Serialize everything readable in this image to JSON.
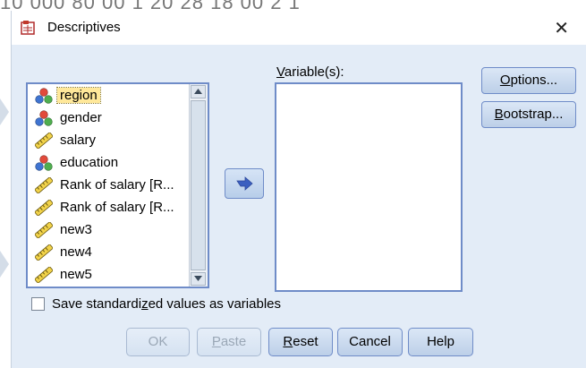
{
  "background_strip": {
    "ghost_text": "10 000      80 00      1 20      28 18 00      2 1"
  },
  "dialog": {
    "title": "Descriptives",
    "close_glyph": "✕"
  },
  "source_list": {
    "items": [
      {
        "label": "region",
        "icon": "nominal-icon",
        "selected": true
      },
      {
        "label": "gender",
        "icon": "nominal-icon",
        "selected": false
      },
      {
        "label": "salary",
        "icon": "scale-ruler-icon",
        "selected": false
      },
      {
        "label": "education",
        "icon": "nominal-icon",
        "selected": false
      },
      {
        "label": "Rank of salary [R...",
        "icon": "scale-ruler-icon",
        "selected": false
      },
      {
        "label": "Rank of salary [R...",
        "icon": "scale-ruler-icon",
        "selected": false
      },
      {
        "label": "new3",
        "icon": "scale-ruler-icon",
        "selected": false
      },
      {
        "label": "new4",
        "icon": "scale-ruler-icon",
        "selected": false
      },
      {
        "label": "new5",
        "icon": "scale-ruler-icon",
        "selected": false
      }
    ]
  },
  "target": {
    "label_prefix": "",
    "label_mnemonic": "V",
    "label_rest": "ariable(s):"
  },
  "side_buttons": {
    "options": {
      "mnemonic": "O",
      "rest": "ptions..."
    },
    "bootstrap": {
      "mnemonic": "B",
      "rest": "ootstrap..."
    }
  },
  "checkbox": {
    "before": "Save standardi",
    "mnemonic": "z",
    "after": "ed values as variables",
    "checked": false
  },
  "bottom_buttons": {
    "ok": {
      "label": "OK",
      "enabled": false
    },
    "paste": {
      "mnemonic": "P",
      "rest": "aste",
      "enabled": false
    },
    "reset": {
      "mnemonic": "R",
      "rest": "eset",
      "enabled": true
    },
    "cancel": {
      "label": "Cancel",
      "enabled": true
    },
    "help": {
      "label": "Help",
      "enabled": true
    }
  },
  "colors": {
    "dialog_bg": "#e3ecf7",
    "selection": "#ffe89a",
    "border_accent": "#6f8cc8",
    "arrow": "#3b5fc0"
  }
}
